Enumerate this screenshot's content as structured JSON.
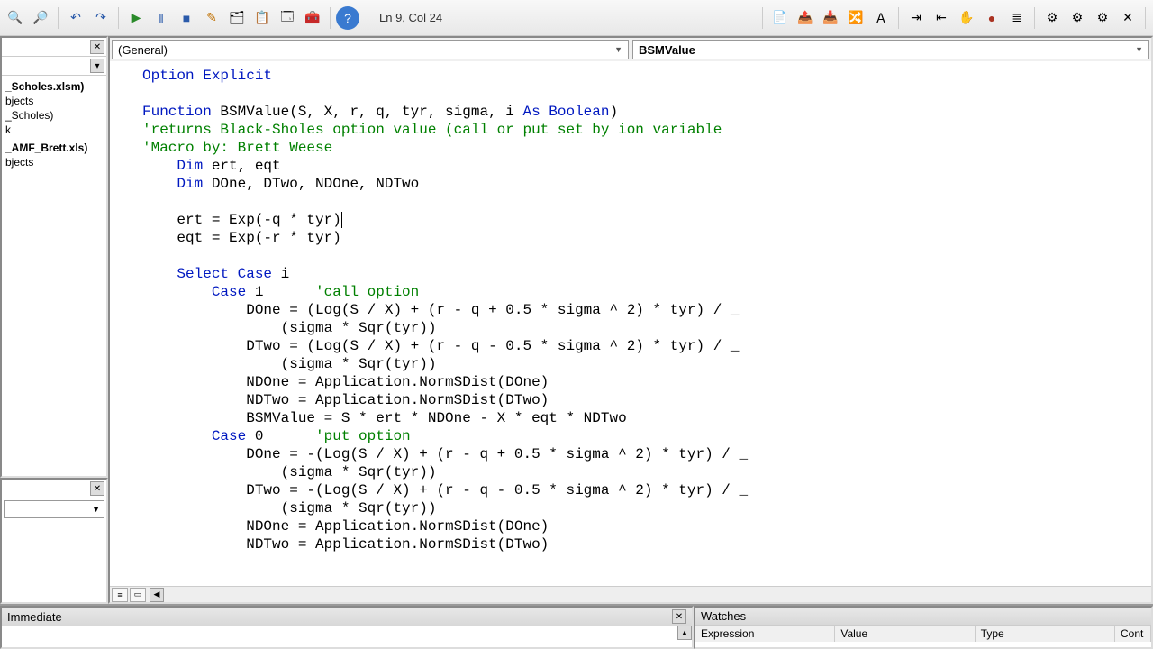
{
  "cursor_position": "Ln 9, Col 24",
  "toolbar_icons": {
    "find": "🔍",
    "findnext": "🔎",
    "undo": "↶",
    "redo": "↷",
    "run": "▶",
    "break": "‖",
    "stop": "■",
    "design": "✎",
    "explorer": "🗂",
    "props": "📋",
    "browser": "🗔",
    "toolbox": "🧰",
    "help": "?",
    "edit1": "📄",
    "edit2": "📤",
    "edit3": "📥",
    "edit4": "🔀",
    "edit5": "Ａ",
    "indent": "⇥",
    "outdent": "⇤",
    "hand": "✋",
    "bp": "●",
    "comment": "≣",
    "b1": "⚙",
    "b2": "⚙",
    "b3": "⚙",
    "b4": "✕"
  },
  "dropdown_left": "(General)",
  "dropdown_right": "BSMValue",
  "project_tree": [
    {
      "text": "_Scholes.xlsm)",
      "bold": true
    },
    {
      "text": "bjects",
      "bold": false
    },
    {
      "text": "_Scholes)",
      "bold": false
    },
    {
      "text": "k",
      "bold": false
    },
    {
      "text": "",
      "bold": false
    },
    {
      "text": "",
      "bold": false
    },
    {
      "text": "_AMF_Brett.xls)",
      "bold": true
    },
    {
      "text": "bjects",
      "bold": false
    }
  ],
  "code": {
    "l1": "Option Explicit",
    "l2_a": "Function",
    "l2_b": " BSMValue(S, X, r, q, tyr, sigma, i ",
    "l2_c": "As Boolean",
    "l2_d": ")",
    "l3": "'returns Black-Sholes option value (call or put set by ion variable",
    "l4": "'Macro by: Brett Weese",
    "l5_a": "    ",
    "l5_b": "Dim",
    "l5_c": " ert, eqt",
    "l6_a": "    ",
    "l6_b": "Dim",
    "l6_c": " DOne, DTwo, NDOne, NDTwo",
    "l7": "",
    "l8": "    ert = Exp(-q * tyr)",
    "l9": "    eqt = Exp(-r * tyr)",
    "l10": "",
    "l11_a": "    ",
    "l11_b": "Select Case",
    "l11_c": " i",
    "l12_a": "        ",
    "l12_b": "Case",
    "l12_c": " 1      ",
    "l12_d": "'call option",
    "l13": "            DOne = (Log(S / X) + (r - q + 0.5 * sigma ^ 2) * tyr) / _",
    "l14": "                (sigma * Sqr(tyr))",
    "l15": "            DTwo = (Log(S / X) + (r - q - 0.5 * sigma ^ 2) * tyr) / _",
    "l16": "                (sigma * Sqr(tyr))",
    "l17": "            NDOne = Application.NormSDist(DOne)",
    "l18": "            NDTwo = Application.NormSDist(DTwo)",
    "l19": "            BSMValue = S * ert * NDOne - X * eqt * NDTwo",
    "l20_a": "        ",
    "l20_b": "Case",
    "l20_c": " 0      ",
    "l20_d": "'put option",
    "l21": "            DOne = -(Log(S / X) + (r - q + 0.5 * sigma ^ 2) * tyr) / _",
    "l22": "                (sigma * Sqr(tyr))",
    "l23": "            DTwo = -(Log(S / X) + (r - q - 0.5 * sigma ^ 2) * tyr) / _",
    "l24": "                (sigma * Sqr(tyr))",
    "l25": "            NDOne = Application.NormSDist(DOne)",
    "l26": "            NDTwo = Application.NormSDist(DTwo)"
  },
  "immediate_title": "Immediate",
  "watches_title": "Watches",
  "watch_cols": [
    "Expression",
    "Value",
    "Type",
    "Cont"
  ]
}
